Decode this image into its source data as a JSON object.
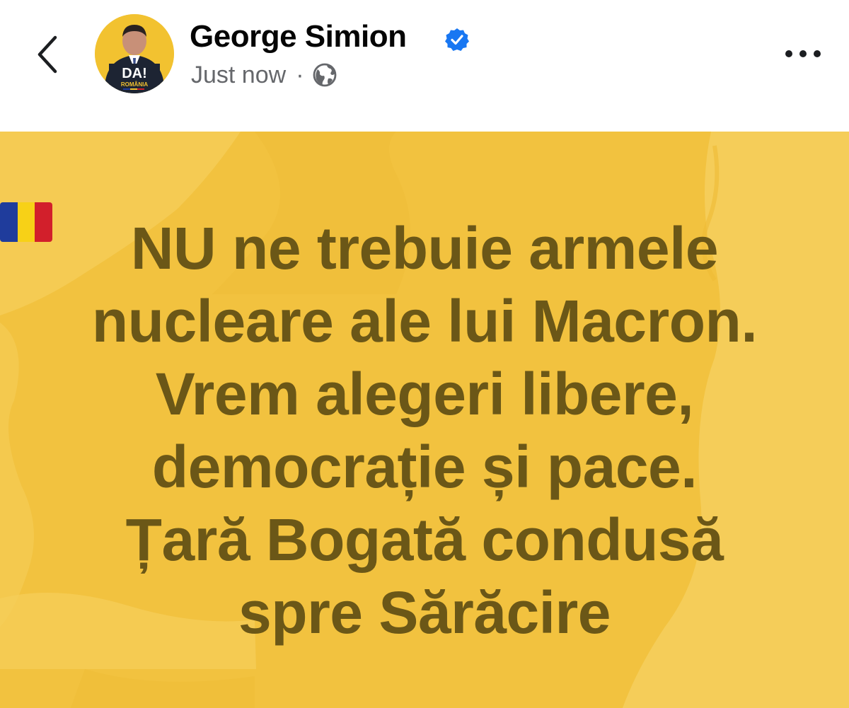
{
  "header": {
    "back_icon": "chevron-left-icon",
    "author_name": "George Simion",
    "verified_icon": "verified-badge-icon",
    "timestamp": "Just now",
    "separator": "·",
    "privacy_icon": "globe-icon",
    "more_icon": "more-horizontal-icon",
    "avatar": {
      "logo_text": "DA!",
      "logo_subtext": "ROMÂNIA"
    }
  },
  "post": {
    "background_color": "#f2c23f",
    "text_color": "#6b5717",
    "lines": [
      "NU ne trebuie armele",
      "nucleare ale lui Macron.",
      "Vrem alegeri libere,",
      "democrație și pace.",
      "Țară Bogată condusă",
      "spre Sărăcire"
    ],
    "flag_icon": "romania-flag-icon"
  },
  "colors": {
    "verified_blue": "#1877f2",
    "meta_gray": "#65676b",
    "name_black": "#050505"
  }
}
